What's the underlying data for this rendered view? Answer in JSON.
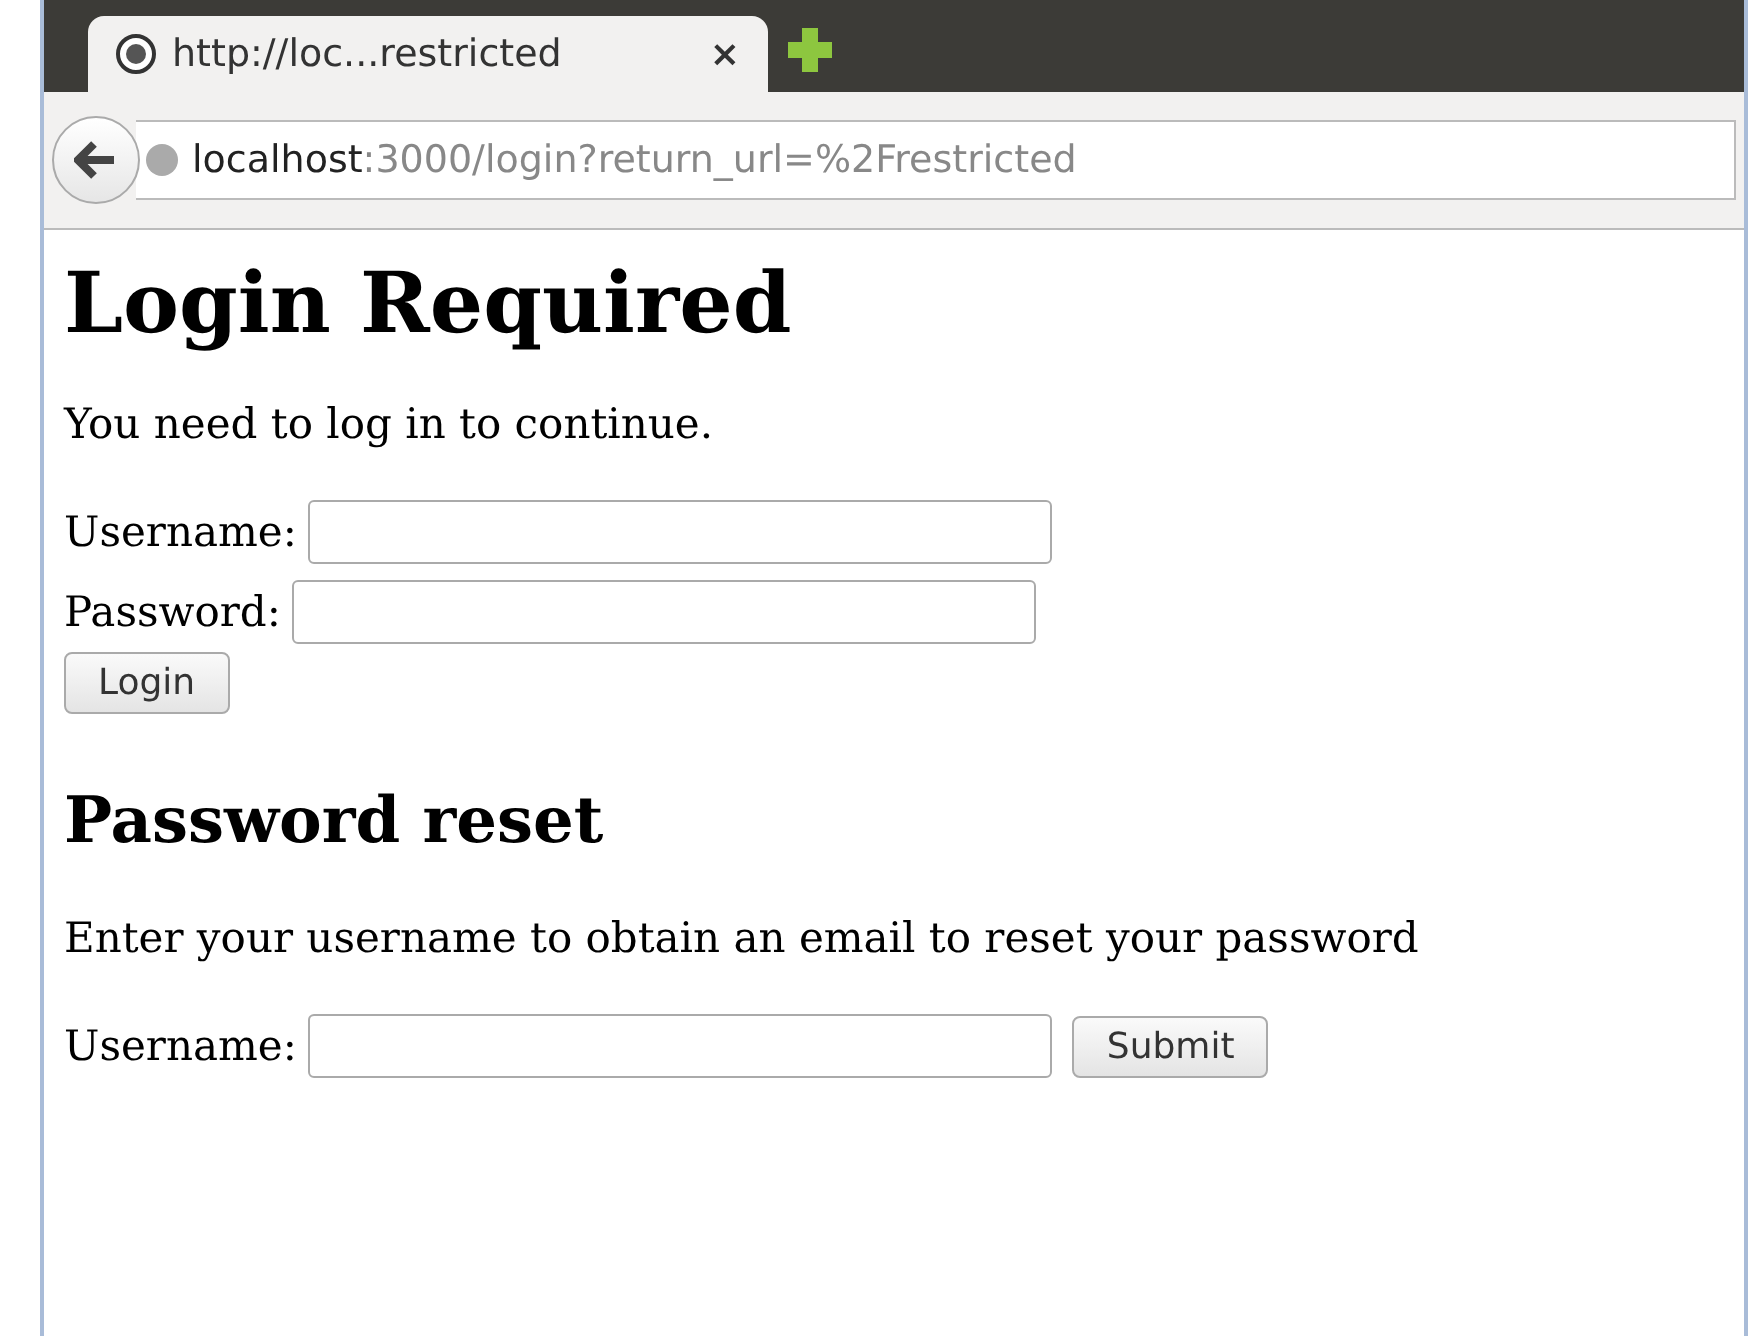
{
  "tab": {
    "title": "http://loc...restricted",
    "close": "×"
  },
  "address_bar": {
    "host": "localhost",
    "path": ":3000/login?return_url=%2Frestricted"
  },
  "login": {
    "heading": "Login Required",
    "message": "You need to log in to continue.",
    "fields": [
      {
        "label": "Username:"
      },
      {
        "label": "Password:"
      }
    ],
    "button": "Login"
  },
  "reset": {
    "heading": "Password reset",
    "message": "Enter your username to obtain an email to reset your password",
    "field": {
      "label": "Username:"
    },
    "button": "Submit"
  }
}
